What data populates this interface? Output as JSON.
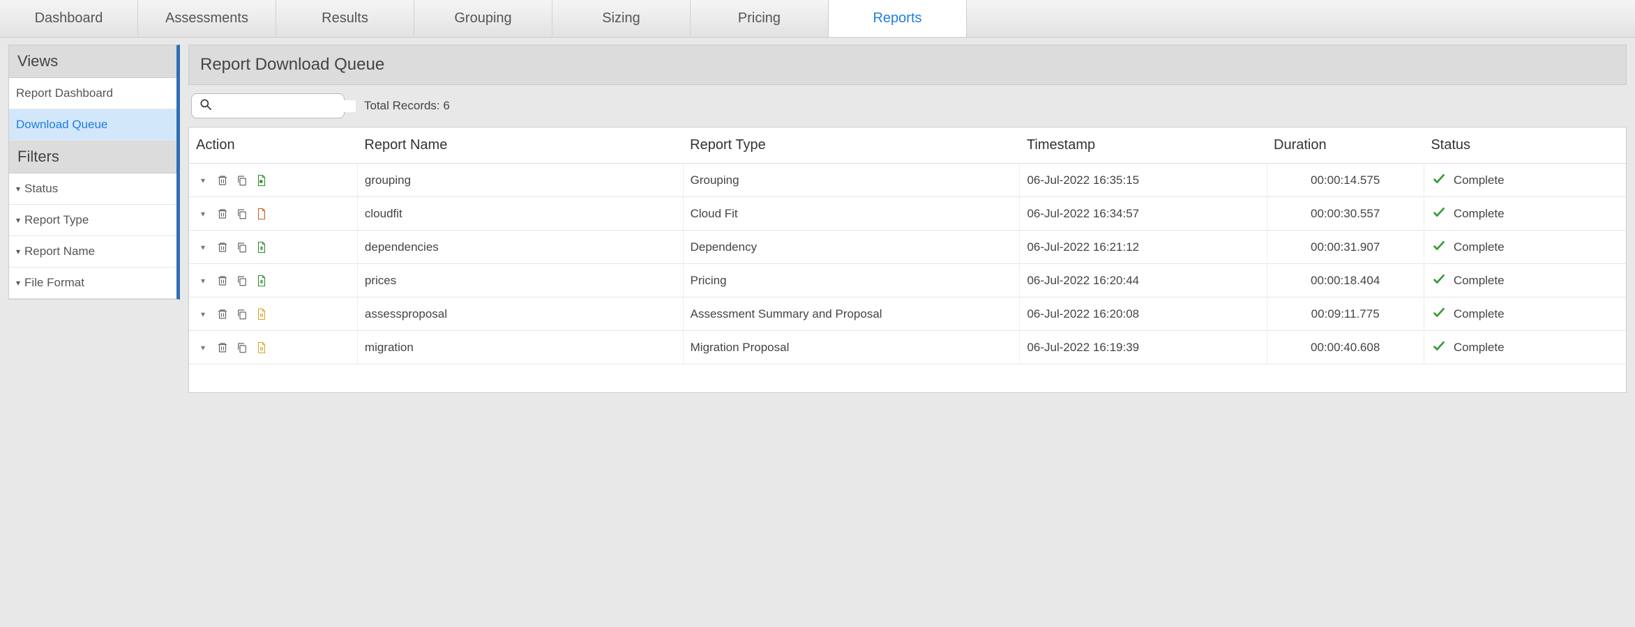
{
  "tabs": [
    "Dashboard",
    "Assessments",
    "Results",
    "Grouping",
    "Sizing",
    "Pricing",
    "Reports"
  ],
  "active_tab": "Reports",
  "sidebar": {
    "views_header": "Views",
    "views": [
      {
        "label": "Report Dashboard",
        "selected": false
      },
      {
        "label": "Download Queue",
        "selected": true
      }
    ],
    "filters_header": "Filters",
    "filters": [
      "Status",
      "Report Type",
      "Report Name",
      "File Format"
    ]
  },
  "page": {
    "title": "Report Download Queue",
    "search_value": "",
    "total_records_label": "Total Records: ",
    "total_records": 6
  },
  "table": {
    "headers": [
      "Action",
      "Report Name",
      "Report Type",
      "Timestamp",
      "Duration",
      "Status"
    ],
    "rows": [
      {
        "name": "grouping",
        "type": "Grouping",
        "timestamp": "06-Jul-2022 16:35:15",
        "duration": "00:00:14.575",
        "status": "Complete",
        "file_kind": "xls"
      },
      {
        "name": "cloudfit",
        "type": "Cloud Fit",
        "timestamp": "06-Jul-2022 16:34:57",
        "duration": "00:00:30.557",
        "status": "Complete",
        "file_kind": "pdf"
      },
      {
        "name": "dependencies",
        "type": "Dependency",
        "timestamp": "06-Jul-2022 16:21:12",
        "duration": "00:00:31.907",
        "status": "Complete",
        "file_kind": "sheet"
      },
      {
        "name": "prices",
        "type": "Pricing",
        "timestamp": "06-Jul-2022 16:20:44",
        "duration": "00:00:18.404",
        "status": "Complete",
        "file_kind": "sheet"
      },
      {
        "name": "assessproposal",
        "type": "Assessment Summary and Proposal",
        "timestamp": "06-Jul-2022 16:20:08",
        "duration": "00:09:11.775",
        "status": "Complete",
        "file_kind": "slide"
      },
      {
        "name": "migration",
        "type": "Migration Proposal",
        "timestamp": "06-Jul-2022 16:19:39",
        "duration": "00:00:40.608",
        "status": "Complete",
        "file_kind": "slide"
      }
    ]
  }
}
